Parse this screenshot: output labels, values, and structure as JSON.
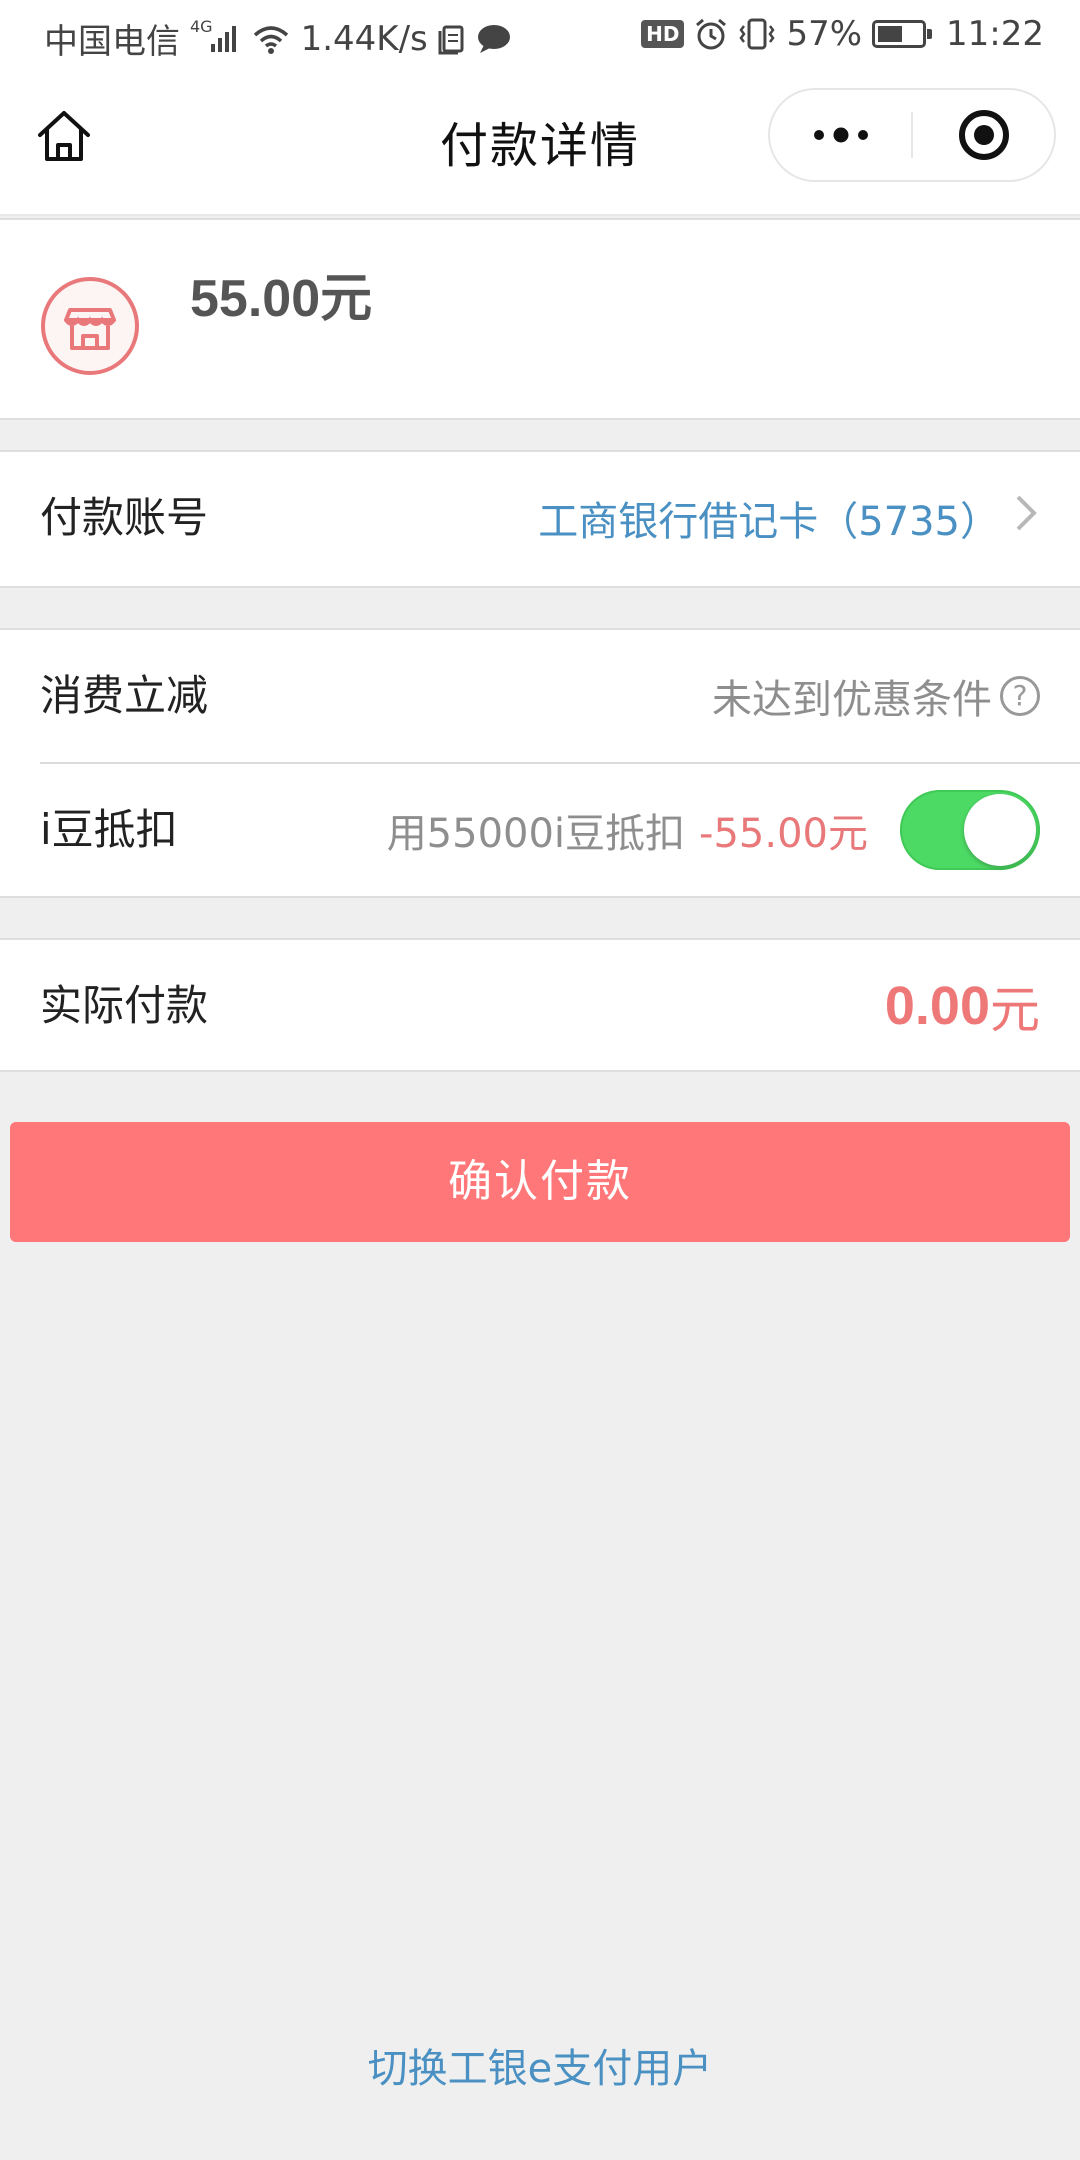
{
  "status_bar": {
    "carrier": "中国电信",
    "network": "4G",
    "speed": "1.44K/s",
    "hd": "HD",
    "battery_pct": "57%",
    "battery_level": 0.57,
    "time": "11:22"
  },
  "nav": {
    "title": "付款详情",
    "home_icon": "home-icon",
    "more_icon": "more-dots-icon",
    "close_icon": "target-close-icon"
  },
  "merchant": {
    "icon": "shop-icon",
    "amount": "55.00元",
    "accent_color": "#e8787a"
  },
  "payment_account": {
    "label": "付款账号",
    "value": "工商银行借记卡（5735）"
  },
  "discount": {
    "label": "消费立减",
    "value": "未达到优惠条件"
  },
  "idou": {
    "label": "i豆抵扣",
    "desc": "用55000i豆抵扣",
    "deduct": "-55.00元",
    "enabled": true
  },
  "actual_payment": {
    "label": "实际付款",
    "amount": "0.00",
    "unit": "元"
  },
  "confirm_button": {
    "label": "确认付款",
    "color": "#ff7778"
  },
  "switch_user": {
    "label": "切换工银e支付用户"
  }
}
